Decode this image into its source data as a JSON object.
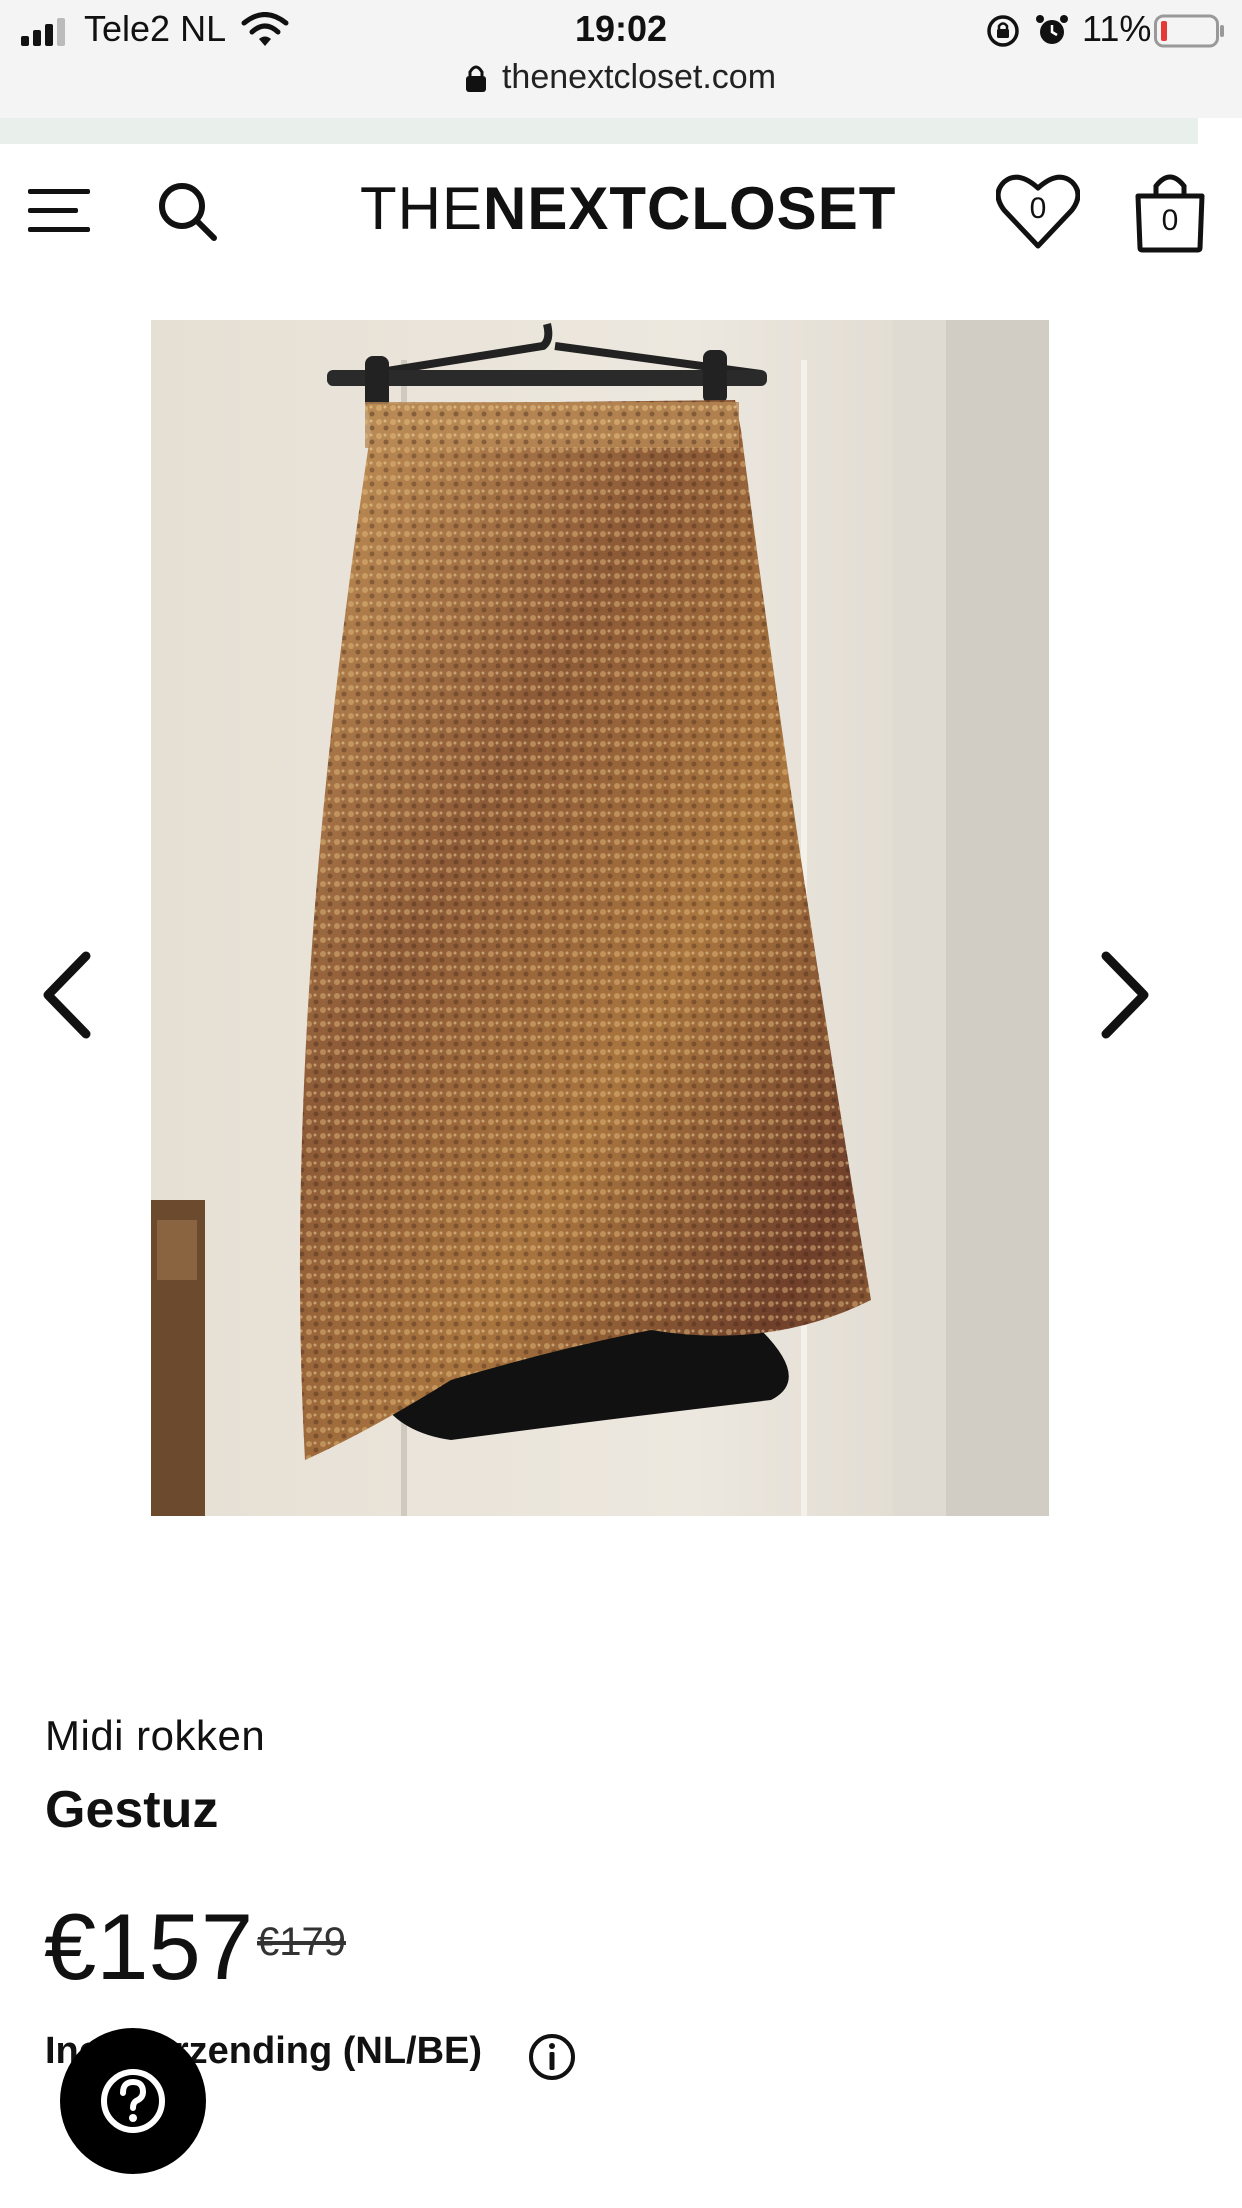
{
  "status_bar": {
    "carrier": "Tele2 NL",
    "time": "19:02",
    "battery_percent": "11%",
    "url": "thenextcloset.com"
  },
  "header": {
    "logo_thin": "THE",
    "logo_bold": "NEXTCLOSET",
    "wishlist_count": "0",
    "cart_count": "0"
  },
  "product": {
    "category": "Midi rokken",
    "brand": "Gestuz",
    "price": "€157",
    "original_price": "€179",
    "shipping_note": "Incl. verzending (NL/BE)"
  },
  "colors": {
    "text": "#111111",
    "status_bar_bg": "#f4f4f4",
    "promo_strip_bg": "#e9efea",
    "battery_low": "#e53935"
  },
  "icons": {
    "menu": "hamburger-icon",
    "search": "search-icon",
    "wishlist": "heart-icon",
    "cart": "shopping-bag-icon",
    "prev": "chevron-left-icon",
    "next": "chevron-right-icon",
    "info": "info-icon",
    "help": "question-icon"
  }
}
